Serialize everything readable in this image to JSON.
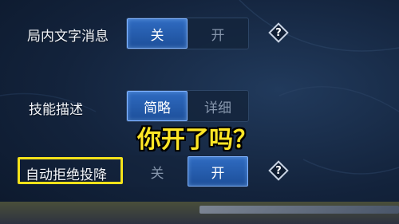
{
  "settings": {
    "rows": [
      {
        "label": "局内文字消息",
        "options": [
          "关",
          "开"
        ],
        "selected": "关",
        "help": "?"
      },
      {
        "label": "技能描述",
        "options": [
          "简略",
          "详细"
        ],
        "selected": "简略"
      },
      {
        "label": "自动拒绝投降",
        "options": [
          "关",
          "开"
        ],
        "selected": "开",
        "help": "?"
      }
    ]
  },
  "caption": "你开了吗？",
  "colors": {
    "accent": "#2f6bc1",
    "highlight": "#f4e21a",
    "caption": "#ffe626"
  }
}
